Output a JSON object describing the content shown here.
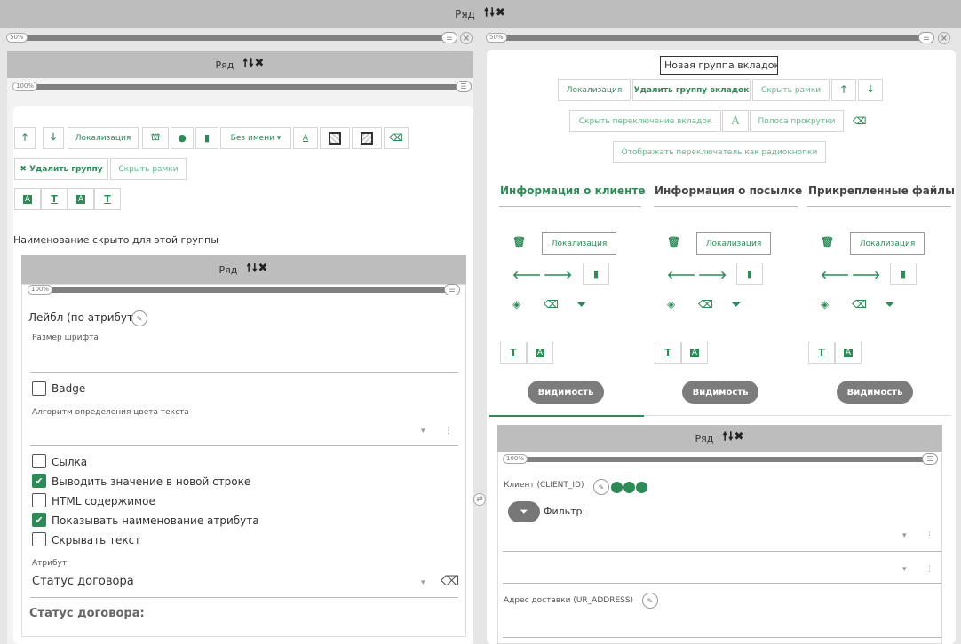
{
  "top": {
    "title": "Ряд",
    "arrows": "🠕🠗✖",
    "left_pct": "50%",
    "right_pct": "50%"
  },
  "left": {
    "row_title": "Ряд",
    "row_pct": "100%",
    "toolbar": {
      "loc": "Локализация",
      "noname": "Без имени ▾",
      "a_letter": "A"
    },
    "delete_group": "✖ Удалить группу",
    "hide_frames": "Скрыть рамки",
    "hidden_note": "Наименование скрыто для этой группы",
    "inner_row_title": "Ряд",
    "inner_pct": "100%",
    "label_attr": "Лейбл (по атрибуту)",
    "font_size": "Размер шрифта",
    "badge": "Badge",
    "color_algo": "Алгоритм определения цвета текста",
    "checkboxes": [
      {
        "label": "Сылка",
        "checked": false
      },
      {
        "label": "Выводить значение в новой строке",
        "checked": true
      },
      {
        "label": "HTML содержимое",
        "checked": false
      },
      {
        "label": "Показывать наименование атрибута",
        "checked": true
      },
      {
        "label": "Скрывать текст",
        "checked": false
      }
    ],
    "attr_label": "Атрибут",
    "attr_value": "Статус договора",
    "status_label": "Статус договора:"
  },
  "right": {
    "group_name": "Новая группа вкладок",
    "btn_loc": "Локализация",
    "btn_delete": "Удалить группу вкладок",
    "btn_hide": "Скрыть рамки",
    "btn_hide_switch": "Скрыть переключение вкладок",
    "btn_A": "A",
    "btn_scroll": "Полоса прокрутки",
    "btn_radio": "Отображать переключатель как радиокнопки",
    "tabs": [
      "Информация о клиенте",
      "Информация о посылке",
      "Прикрепленные файлы"
    ],
    "tab_loc": "Локализация",
    "visibility": "Видимость",
    "row_title": "Ряд",
    "row_pct": "100%",
    "client": "Клиент (CLIENT_ID)",
    "filter": "Фильтр:",
    "address": "Адрес доставки (UR_ADDRESS)"
  },
  "colors": {
    "accent": "#2e8b57",
    "header": "#bdbdbd",
    "bar": "#808080"
  }
}
